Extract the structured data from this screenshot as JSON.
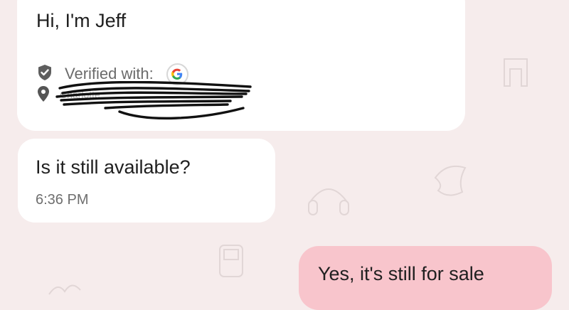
{
  "conversation": {
    "intro": {
      "title": "Hi, I'm Jeff",
      "verified_label": "Verified with:",
      "verified_provider_icon": "google-icon",
      "location_redacted_text": "Charlotte",
      "shield_icon": "shield-check-icon",
      "pin_icon": "location-pin-icon"
    },
    "incoming_message": {
      "text": "Is it still available?",
      "time": "6:36 PM"
    },
    "outgoing_message": {
      "text": "Yes, it's still for sale"
    }
  },
  "colors": {
    "background": "#f6ecec",
    "incoming_bubble": "#ffffff",
    "outgoing_bubble": "#f8c5cc",
    "google_blue": "#4285f4"
  }
}
